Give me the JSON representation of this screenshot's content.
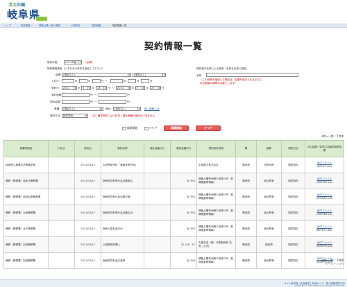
{
  "header": {
    "logo_top_pre": "清流",
    "logo_top_accent": "の国",
    "logo_main": "岐阜県"
  },
  "nav": {
    "items": [
      "トップ",
      "県政情報",
      "情報公開・個人情報",
      "公表資料",
      "契約情報",
      "契約情報一覧"
    ]
  },
  "page": {
    "title": "契約情報一覧"
  },
  "search": {
    "year_label": "契約年度：",
    "year_value": "2011年度",
    "year_req": "（必須）",
    "cond_title": "契約情報検索（いずれかの条件を指定して下さい）",
    "dept_label": "部署：",
    "dept_value": "(指定なし)",
    "dept2_value": "(指定なし)",
    "date_label": "入札日：",
    "date_sep_year": "年",
    "date_sep_month": "月",
    "date_sep_day": "日",
    "date_tilde": "～",
    "contract_date_label": "契約日：",
    "cd_from_year": "2011",
    "cd_from_month": "3",
    "cd_from_day": "18",
    "cd_to_year": "2011",
    "cd_to_month": "3",
    "cd_to_day": "27",
    "amount_label": "落札価格：",
    "contract_amount_label": "契約金額：",
    "yen_unit": "円",
    "type_label": "業種：",
    "type_value": "(指定なし)",
    "biz_label": "細目：",
    "biz_value": "(指定なし)",
    "clear_link": "細・細節とは",
    "method_label": "契約方法：",
    "method_value": "随意契約",
    "method_note": "（注）随意契約には入札日、落札価格の指定はできません",
    "supplier_title": "契約相手名称による検索（名称を全角で指定）",
    "supplier_label": "名称：",
    "supplier_value": "",
    "supplier_note1": "（この検索を指定した場合は、結果が表示されるまでに",
    "supplier_note2": "ある程度の時間を必要とします）",
    "search_img_label": "検索開始",
    "clear_img_label": "クリア",
    "search_button": "検索開始",
    "clear_button": "クリア"
  },
  "results": {
    "count_top": "1件～7件／7件中",
    "count_bottom": "1件～7件／7件中",
    "columns": [
      "部署所属名",
      "入札日",
      "契約日",
      "契約名称",
      "落札価格(円)",
      "契約金額(円)",
      "契約相手名称",
      "節",
      "細節",
      "契約方法",
      "入札結果一覧表又は随意契約結果"
    ],
    "rows": [
      {
        "dept": "岐阜県立看護大学看護学部",
        "bid": "",
        "date": "2011/03/25",
        "name": "大学院研究科「看護学研究科」",
        "price": "",
        "amount": "",
        "partner": "中部電力株式会社",
        "sec": "需用費",
        "sub": "光熱水費",
        "method": "随意契約",
        "file": "添付ファイル",
        "fileid": "(K0105.doc)"
      },
      {
        "dept": "警察（警察署）岐阜中警察署",
        "bid": "",
        "date": "2011/03/25",
        "name": "宿舎賃貸料等代金自動振込",
        "price": "",
        "amount": "@ 393",
        "partner": "情報公開条例第６条第４号（犯罪捜査等情報）",
        "sec": "需用費",
        "sub": "総合費等",
        "method": "随意契約",
        "file": "添付ファイル",
        "fileid": "(K09959.xls)"
      },
      {
        "dept": "警察（警察署）岐阜羽島警察署",
        "bid": "",
        "date": "2011/03/25",
        "name": "宿舎賃貸料代金自動引落",
        "price": "",
        "amount": "@ 393",
        "partner": "情報公開条例第６条第４号（犯罪捜査等情報）",
        "sec": "需用費",
        "sub": "総合費等",
        "method": "随意契約",
        "file": "添付ファイル",
        "fileid": "(K09862.pdf)"
      },
      {
        "dept": "警察（警察署）大垣警察署",
        "bid": "",
        "date": "2011/03/25",
        "name": "宿舎賃貸料等代金自動払出",
        "price": "",
        "amount": "@ 393",
        "partner": "情報公開条例第６条第４号（犯罪捜査等情報）",
        "sec": "需用費",
        "sub": "総合費等",
        "method": "随意契約",
        "file": "添付ファイル",
        "fileid": "(K09883.xls)"
      },
      {
        "dept": "警察（警察署）北方警察署",
        "bid": "",
        "date": "2011/03/25",
        "name": "宿舎入居料金引出",
        "price": "",
        "amount": "@ 393",
        "partner": "情報公開条例第６条第４号（犯罪捜査等情報）",
        "sec": "需用費",
        "sub": "総合費等",
        "method": "随意契約",
        "file": "添付ファイル",
        "fileid": "(K09871.doc)"
      },
      {
        "dept": "警察（警察署）加茂警察署",
        "bid": "",
        "date": "2011/03/25",
        "name": "公用車燃料購入",
        "price": "",
        "amount": "@ 148、37",
        "partner": "丸善石油（株）代表取締役 社長 上山内",
        "sec": "需用費",
        "sub": "燃料費",
        "method": "随意契約",
        "file": "添付ファイル",
        "fileid": "(K08999.pdf)"
      },
      {
        "dept": "警察（警察署）加茂警察署",
        "bid": "",
        "date": "2011/03/25",
        "name": "宿舎賃貸料金引落等",
        "price": "",
        "amount": "@ 393",
        "partner": "情報公開条例第６条第４号（犯罪捜査等情報）",
        "sec": "需用費",
        "sub": "総合費等",
        "method": "随意契約",
        "file": "添付ファイル",
        "fileid": "(K08999.pdf)"
      }
    ],
    "pagetop": "ページトップへ"
  },
  "footer": {
    "links": "サイト案内図 | 免責事項 | 利用ガイド | 県の情報提供方針",
    "copy": "Copyright © Gifu Prefecture. All rights reserved."
  }
}
